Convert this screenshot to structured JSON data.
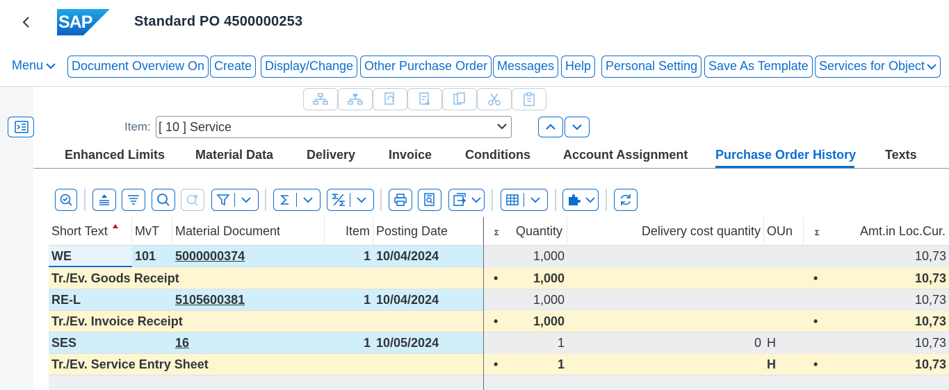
{
  "header": {
    "title": "Standard PO 4500000253",
    "logo_text": "SAP"
  },
  "menubar": {
    "menu_label": "Menu",
    "buttons": [
      {
        "label": "Document Overview On"
      },
      {
        "label": "Create"
      },
      {
        "label": "Display/Change"
      },
      {
        "label": "Other Purchase Order"
      },
      {
        "label": "Messages"
      },
      {
        "label": "Help"
      },
      {
        "label": "Personal Setting"
      },
      {
        "label": "Save As Template"
      },
      {
        "label": "Services for Object"
      }
    ]
  },
  "item_selector": {
    "label": "Item:",
    "value": "[ 10 ] Service"
  },
  "tabs": [
    {
      "label": "Enhanced Limits"
    },
    {
      "label": "Material Data"
    },
    {
      "label": "Delivery"
    },
    {
      "label": "Invoice"
    },
    {
      "label": "Conditions"
    },
    {
      "label": "Account Assignment"
    },
    {
      "label": "Purchase Order History",
      "active": true
    },
    {
      "label": "Texts"
    }
  ],
  "table": {
    "columns": {
      "short_text": "Short Text",
      "mvt": "MvT",
      "material_document": "Material Document",
      "item": "Item",
      "posting_date": "Posting Date",
      "sigma1": "Σ",
      "quantity": "Quantity",
      "delivery_cost_quantity": "Delivery cost quantity",
      "oun": "OUn",
      "sigma2": "Σ",
      "amt_loc_cur": "Amt.in Loc.Cur."
    },
    "rows": [
      {
        "type": "detail",
        "short_text": "WE",
        "mvt": "101",
        "material_document": "5000000374",
        "item": "1",
        "posting_date": "10/04/2024",
        "quantity": "1,000",
        "delivery_cost_quantity": "",
        "oun": "",
        "amount": "10,73"
      },
      {
        "type": "subtotal",
        "short_text": "Tr./Ev. Goods Receipt",
        "dot1": "•",
        "quantity": "1,000",
        "oun": "",
        "dot2": "•",
        "amount": "10,73"
      },
      {
        "type": "detail",
        "short_text": "RE-L",
        "mvt": "",
        "material_document": "5105600381",
        "item": "1",
        "posting_date": "10/04/2024",
        "quantity": "1,000",
        "delivery_cost_quantity": "",
        "oun": "",
        "amount": "10,73"
      },
      {
        "type": "subtotal",
        "short_text": "Tr./Ev. Invoice Receipt",
        "dot1": "•",
        "quantity": "1,000",
        "oun": "",
        "dot2": "•",
        "amount": "10,73"
      },
      {
        "type": "detail",
        "short_text": "SES",
        "mvt": "",
        "material_document": "16",
        "item": "1",
        "posting_date": "10/05/2024",
        "quantity": "1",
        "delivery_cost_quantity": "0",
        "oun": "H",
        "amount": "10,73"
      },
      {
        "type": "subtotal",
        "short_text": "Tr./Ev. Service Entry Sheet",
        "dot1": "•",
        "quantity": "1",
        "oun": "H",
        "dot2": "•",
        "amount": "10,73"
      }
    ]
  },
  "colors": {
    "accent": "#0a6ed1",
    "row_blue": "#d1effa",
    "row_yellow": "#fdf6d0"
  }
}
